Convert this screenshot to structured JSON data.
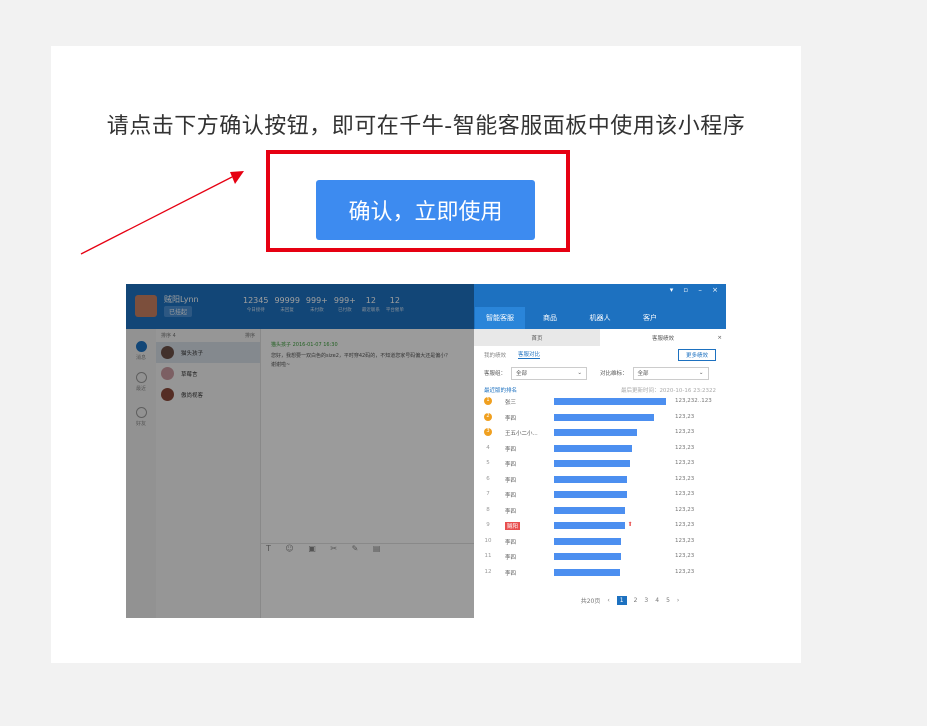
{
  "instruction": "请点击下方确认按钮，即可在千牛-智能客服面板中使用该小程序",
  "confirm_button": "确认，立即使用",
  "colors": {
    "accent": "#3d8bf0",
    "highlight": "#e60012",
    "background": "#f2f2f2"
  },
  "preview": {
    "user_name": "贼阳Lynn",
    "user_status": "已挂起",
    "stats": [
      {
        "value": "12345",
        "label": "今日接待"
      },
      {
        "value": "99999",
        "label": "未回复"
      },
      {
        "value": "999+",
        "label": "未付款"
      },
      {
        "value": "999+",
        "label": "已付款"
      },
      {
        "value": "12",
        "label": "最近联系"
      },
      {
        "value": "12",
        "label": "平台催单"
      }
    ],
    "window_controls": "▾ ▫ – ×",
    "top_tabs": [
      "智能客服",
      "商品",
      "机器人",
      "客户"
    ],
    "sidebar_items": [
      "消息",
      "最近",
      "好友"
    ],
    "list_header": {
      "left": "排序 4",
      "right": "排序"
    },
    "contacts": [
      "猫头孩子",
      "草莓言",
      "傲尚视客"
    ],
    "chat": {
      "meta": "猫头孩子 2016-01-07 16:30",
      "text": "您好，我想要一双白色的size2，平时穿42码的，不知道您家号码偏大还是偏小？谢谢啦~"
    },
    "toolbar_icons": "T ☺ ▣ ✂ ✎ ▤",
    "panel_tabs": [
      "首页",
      "客服绩效"
    ],
    "panel_close": "×",
    "subtabs": [
      "我的绩效",
      "客服对比"
    ],
    "more_button": "更多绩效",
    "filters": {
      "group_label": "客服组：",
      "group_value": "全部",
      "compare_label": "对比维标：",
      "compare_value": "全部"
    },
    "ranking_title": "最近版的排名",
    "updated_at": "最后更新时间：2020-10-16 23:2322",
    "ranking": [
      {
        "rank": "1",
        "name": "张三",
        "score": "123,232..123",
        "value": 100
      },
      {
        "rank": "2",
        "name": "李四",
        "score": "123,23",
        "value": 89
      },
      {
        "rank": "3",
        "name": "王五小二小...",
        "score": "123,23",
        "value": 74
      },
      {
        "rank": "4",
        "name": "李四",
        "score": "123,23",
        "value": 70
      },
      {
        "rank": "5",
        "name": "李四",
        "score": "123,23",
        "value": 68
      },
      {
        "rank": "6",
        "name": "李四",
        "score": "123,23",
        "value": 65
      },
      {
        "rank": "7",
        "name": "李四",
        "score": "123,23",
        "value": 65
      },
      {
        "rank": "8",
        "name": "李四",
        "score": "123,23",
        "value": 63
      },
      {
        "rank": "9",
        "name": "贼阳",
        "score": "123,23",
        "value": 63
      },
      {
        "rank": "10",
        "name": "李四",
        "score": "123,23",
        "value": 60
      },
      {
        "rank": "11",
        "name": "李四",
        "score": "123,23",
        "value": 60
      },
      {
        "rank": "12",
        "name": "李四",
        "score": "123,23",
        "value": 59
      }
    ],
    "pager": {
      "total": "共20页",
      "prev": "‹",
      "pages": [
        "1",
        "2",
        "3",
        "4",
        "5"
      ],
      "next": "›"
    }
  }
}
